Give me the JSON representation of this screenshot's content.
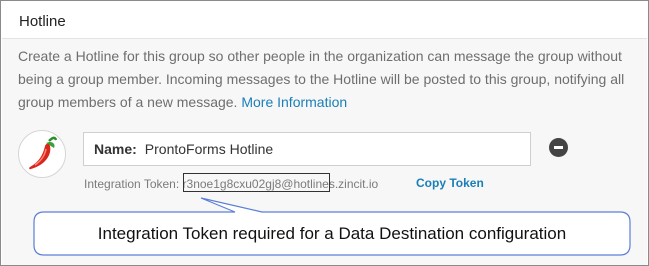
{
  "section": {
    "title": "Hotline",
    "description": "Create a Hotline for this group so other people in the organization can message the group without being a group member. Incoming messages to the Hotline will be posted to this group, notifying all group members of a new message.",
    "more_info_link": "More Information"
  },
  "hotline": {
    "avatar_icon": "chili-pepper-icon",
    "name_label": "Name:",
    "name_value": "ProntoForms Hotline",
    "remove_icon": "minus-circle-icon",
    "token_label": "Integration Token:",
    "token_value": "r3noe1g8cxu02gj8@hotlines.zincit.io",
    "copy_token_label": "Copy Token"
  },
  "callout": {
    "text": "Integration Token required for a Data Destination configuration"
  },
  "colors": {
    "link": "#1a7fb8",
    "callout_border": "#5b7fd6",
    "content_bg": "#f7f7f7"
  }
}
